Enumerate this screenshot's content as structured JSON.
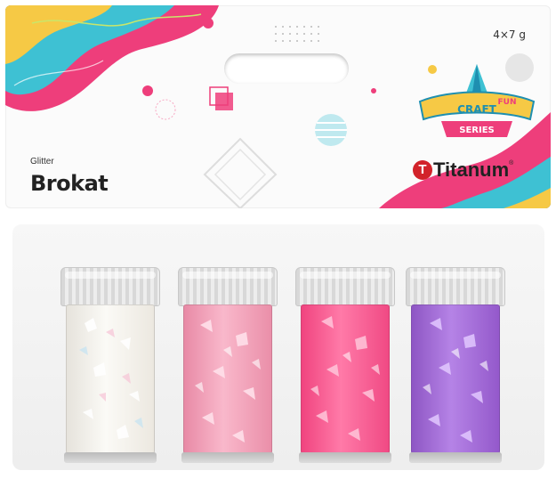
{
  "product": {
    "subtitle": "Glitter",
    "title": "Brokat",
    "quantity": "4×7 g",
    "brand": "Titanum",
    "series_logo_text": [
      "CRAFT",
      "FUN",
      "SERIES"
    ]
  },
  "jars": [
    {
      "color": "white-iridescent",
      "hex": "#f4f1ec"
    },
    {
      "color": "light-pink",
      "hex": "#f49ab4"
    },
    {
      "color": "hot-pink",
      "hex": "#ff5f9a"
    },
    {
      "color": "violet",
      "hex": "#a66fd6"
    }
  ],
  "colors": {
    "accent_pink": "#ee3e7b",
    "accent_cyan": "#3ec1d3",
    "accent_yellow": "#f6c945",
    "brand_red": "#d2232a"
  }
}
